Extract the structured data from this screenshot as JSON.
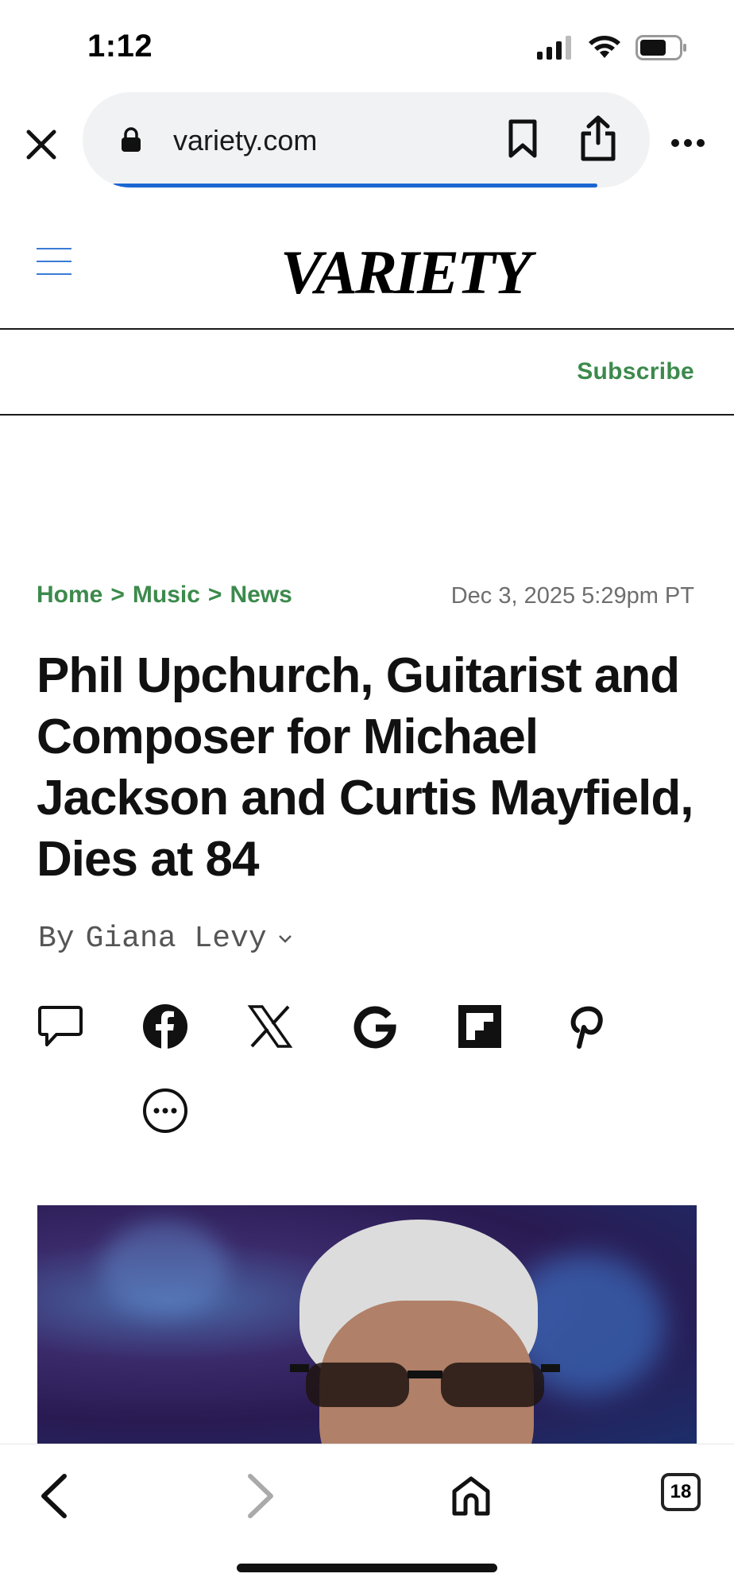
{
  "status_bar": {
    "time": "1:12",
    "icons": [
      "cellular-signal-icon",
      "wifi-icon",
      "battery-icon"
    ]
  },
  "browser": {
    "url": "variety.com",
    "close_icon": "close-icon",
    "lock_icon": "lock-icon",
    "bookmark_icon": "bookmark-icon",
    "share_icon": "share-icon",
    "more_icon": "more-horizontal-icon",
    "accent_color": "#1b66d2"
  },
  "site": {
    "logo": "VARIETY",
    "menu_icon": "hamburger-menu-icon",
    "subscribe_label": "Subscribe",
    "accent_color": "#3c8a4c"
  },
  "article": {
    "breadcrumb": [
      "Home",
      "Music",
      "News"
    ],
    "breadcrumb_separator": ">",
    "date": "Dec 3, 2025 5:29pm PT",
    "headline": "Phil Upchurch, Guitarist and Composer for Michael Jackson and Curtis Mayfield, Dies at 84",
    "byline_prefix": "By",
    "author": "Giana Levy",
    "share_icons": [
      "comment-icon",
      "facebook-icon",
      "x-icon",
      "google-icon",
      "flipboard-icon",
      "pinterest-icon",
      "more-options-icon"
    ]
  },
  "toolbar": {
    "back_icon": "back-arrow-icon",
    "forward_icon": "forward-arrow-icon",
    "home_icon": "home-icon",
    "tab_count": "18"
  }
}
